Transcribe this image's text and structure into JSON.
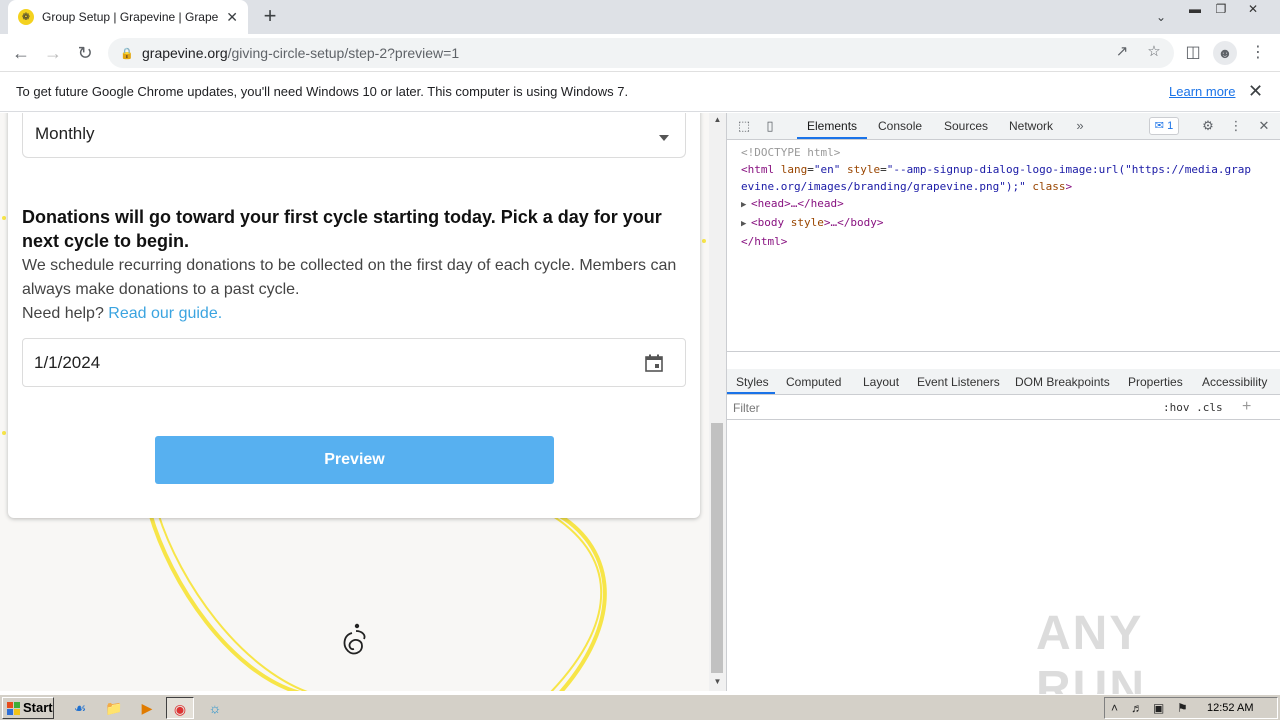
{
  "browser": {
    "tab_title": "Group Setup | Grapevine | Grapevine",
    "tab_favicon": "grapevine-favicon",
    "new_tab_label": "+",
    "url_host": "grapevine.org",
    "url_path": "/giving-circle-setup/step-2?preview=1"
  },
  "infobar": {
    "message": "To get future Google Chrome updates, you'll need Windows 10 or later. This computer is using Windows 7.",
    "learn_more": "Learn more"
  },
  "page": {
    "frequency_value": "Monthly",
    "heading": "Donations will go toward your first cycle starting today. Pick a day for your next cycle to begin.",
    "description": "We schedule recurring donations to be collected on the first day of each cycle. Members can always make donations to a past cycle.",
    "help_prefix": "Need help?",
    "help_link": "Read our guide.",
    "date_value": "1/1/2024",
    "preview_button": "Preview",
    "accent_color": "#57b0f0",
    "deco_color": "#f7e548"
  },
  "devtools": {
    "tabs": [
      "Elements",
      "Console",
      "Sources",
      "Network"
    ],
    "issues_count": "1",
    "dom": {
      "doctype": "<!DOCTYPE html>",
      "html_open_a": "<html ",
      "html_attr_lang": "lang",
      "html_val_lang": "\"en\"",
      "html_attr_style": "style",
      "html_val_style_1": "\"--amp-signup-dialog-logo-image:url(\"https://media.grap",
      "html_val_style_2": "evine.org/images/branding/grapevine.png\");\"",
      "html_attr_class": "class",
      "html_close_a": ">",
      "head": "<head>…</head>",
      "body_open": "<body ",
      "body_attr": "style",
      "body_close": ">…</body>",
      "html_end": "</html>"
    },
    "style_tabs": [
      "Styles",
      "Computed",
      "Layout",
      "Event Listeners",
      "DOM Breakpoints",
      "Properties",
      "Accessibility"
    ],
    "filter_placeholder": "Filter",
    "hov": ":hov",
    "cls": ".cls"
  },
  "watermark": "ANY RUN",
  "taskbar": {
    "start": "Start",
    "time": "12:52 AM"
  }
}
